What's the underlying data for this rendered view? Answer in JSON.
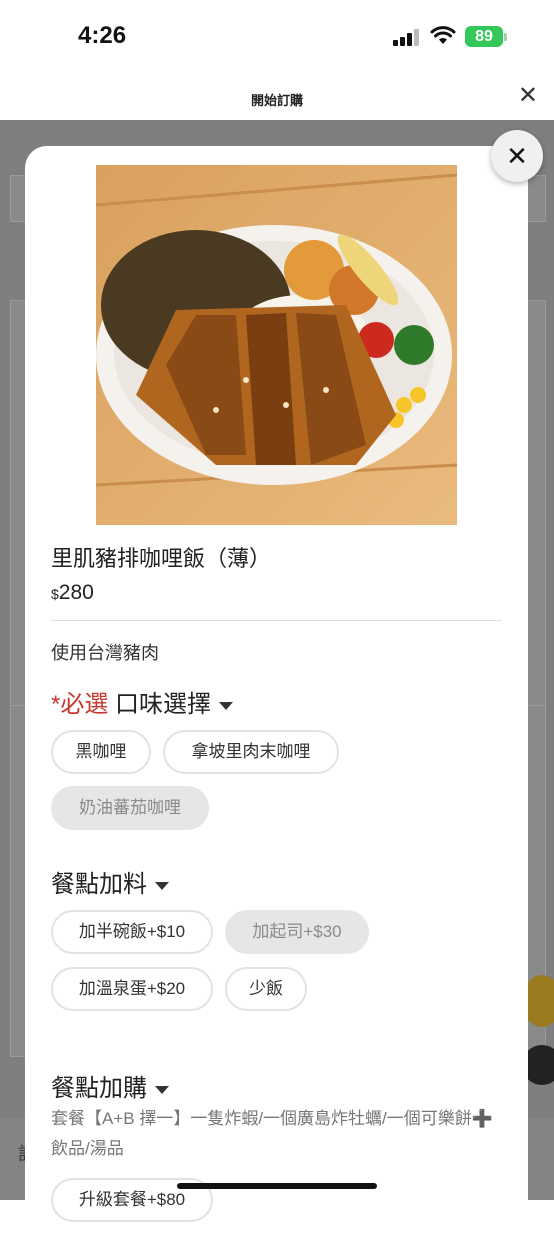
{
  "status_bar": {
    "time": "4:26",
    "battery": "89"
  },
  "web_header": {
    "title": "開始訂購",
    "close_icon": "close-icon"
  },
  "background": {
    "bottom_text": "訂"
  },
  "item": {
    "name": "里肌豬排咖哩飯（薄）",
    "currency": "$",
    "price": "280",
    "description": "使用台灣豬肉"
  },
  "flavor": {
    "required_label": "*必選",
    "title": "口味選擇",
    "options": [
      {
        "label": "黑咖哩",
        "disabled": false
      },
      {
        "label": "拿坡里肉末咖哩",
        "disabled": false
      },
      {
        "label": "奶油蕃茄咖哩",
        "disabled": true
      }
    ]
  },
  "toppings": {
    "title": "餐點加料",
    "options": [
      {
        "label": "加半碗飯+$10",
        "disabled": false
      },
      {
        "label": "加起司+$30",
        "disabled": true
      },
      {
        "label": "加溫泉蛋+$20",
        "disabled": false
      },
      {
        "label": "少飯",
        "disabled": false
      }
    ]
  },
  "addons": {
    "title": "餐點加購",
    "description": "套餐【A+B 擇一】一隻炸蝦/一個廣島炸牡蠣/一個可樂餅➕ 飲品/湯品",
    "options": [
      {
        "label": "升級套餐+$80"
      }
    ]
  },
  "colors": {
    "required": "#c8372d",
    "disabled_chip": "#e6e6e6",
    "battery": "#34c759"
  }
}
